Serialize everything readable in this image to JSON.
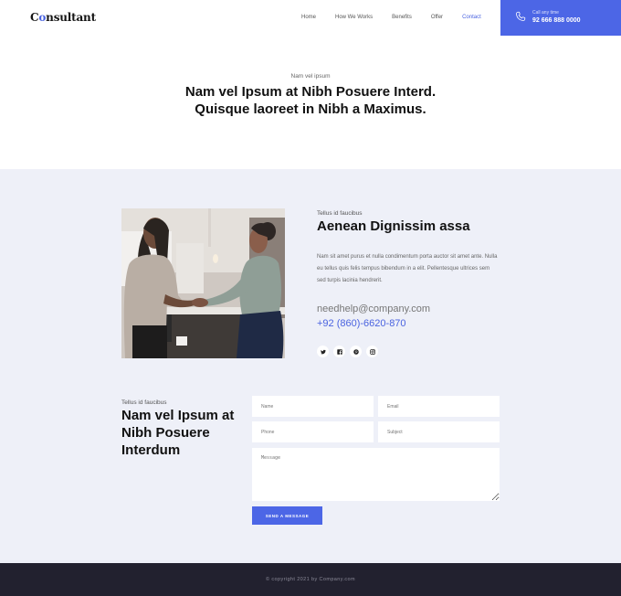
{
  "header": {
    "logo_prefix": "C",
    "logo_o": "o",
    "logo_rest": "nsultant",
    "nav": [
      "Home",
      "How We Works",
      "Benefits",
      "Offer",
      "Contact"
    ],
    "active_nav": "Contact",
    "call_label": "Call any time",
    "call_number": "92 666 888 0000"
  },
  "hero": {
    "subtitle": "Nam vel ipsum",
    "title": "Nam vel Ipsum at Nibh Posuere Interd. Quisque laoreet in Nibh a Maximus."
  },
  "about": {
    "subtitle": "Tellus id faucibus",
    "title": "Aenean Dignissim assa",
    "text": "Nam sit amet purus et nulla condimentum porta auctor sit amet ante. Nulla eu tellus quis felis tempus bibendum in a elit. Pellentesque ultrices sem sed turpis lacinia hendrerit.",
    "email": "needhelp@company.com",
    "phone": "+92 (860)-6620-870",
    "social_icons": [
      "twitter-icon",
      "facebook-icon",
      "pinterest-icon",
      "instagram-icon"
    ]
  },
  "contact": {
    "subtitle": "Tellus id faucibus",
    "title": "Nam vel Ipsum at Nibh Posuere Interdum",
    "placeholders": {
      "name": "Name",
      "email": "Email",
      "phone": "Phone",
      "subject": "Subject",
      "message": "Message"
    },
    "send_label": "SEND A MESSAGE"
  },
  "footer": {
    "copyright": "© copyright 2021 by Company.com"
  },
  "colors": {
    "accent": "#4c66e6",
    "light_bg": "#eef0f8",
    "footer_bg": "#22212f"
  }
}
